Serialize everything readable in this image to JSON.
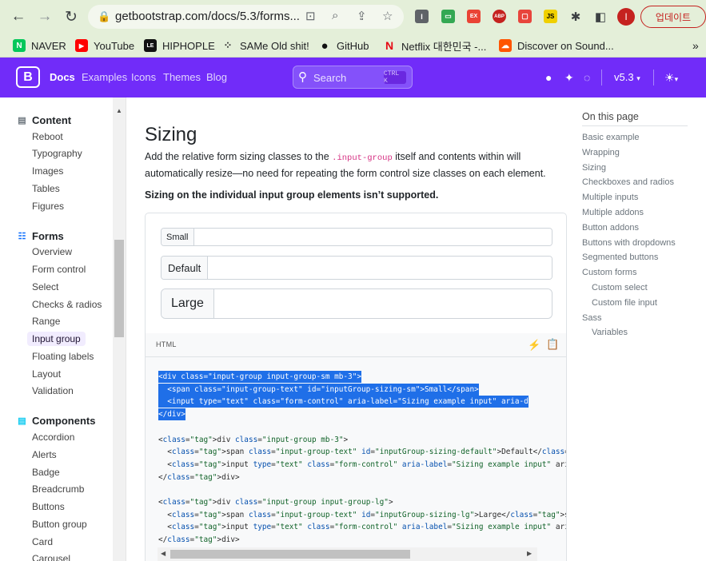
{
  "browser": {
    "url": "getbootstrap.com/docs/5.3/forms...",
    "update_label": "업데이트",
    "profile_initial": "I",
    "bookmarks": [
      {
        "label": "NAVER",
        "icon": "N"
      },
      {
        "label": "YouTube",
        "icon": "▶"
      },
      {
        "label": "HIPHOPLE",
        "icon": "LE"
      },
      {
        "label": "SAMe Old shit!",
        "icon": "⁘"
      },
      {
        "label": "GitHub",
        "icon": "●"
      },
      {
        "label": "Netflix 대한민국 -...",
        "icon": "N"
      },
      {
        "label": "Discover on Sound...",
        "icon": "☁"
      }
    ],
    "more_bookmarks": "»"
  },
  "navbar": {
    "logo": "B",
    "brand": "Docs",
    "links": [
      "Examples",
      "Icons",
      "Themes",
      "Blog"
    ],
    "search_placeholder": "Search",
    "search_kbd": "CTRL K",
    "version": "v5.3",
    "theme_caret": "▾"
  },
  "sidebar": {
    "sections": [
      {
        "title": "Content",
        "items": [
          "Reboot",
          "Typography",
          "Images",
          "Tables",
          "Figures"
        ]
      },
      {
        "title": "Forms",
        "items": [
          "Overview",
          "Form control",
          "Select",
          "Checks & radios",
          "Range",
          "Input group",
          "Floating labels",
          "Layout",
          "Validation"
        ]
      },
      {
        "title": "Components",
        "items": [
          "Accordion",
          "Alerts",
          "Badge",
          "Breadcrumb",
          "Buttons",
          "Button group",
          "Card",
          "Carousel"
        ]
      }
    ],
    "active_item": "Input group"
  },
  "main": {
    "title": "Sizing",
    "para_before": "Add the relative form sizing classes to the ",
    "para_code": ".input-group",
    "para_after": " itself and contents within will automatically resize—no need for repeating the form control size classes on each element.",
    "bold_note": "Sizing on the individual input group elements isn’t supported.",
    "examples": [
      {
        "label": "Small"
      },
      {
        "label": "Default"
      },
      {
        "label": "Large"
      }
    ],
    "code_lang": "HTML",
    "code_lines": [
      "<div class=\"input-group input-group-sm mb-3\">",
      "  <span class=\"input-group-text\" id=\"inputGroup-sizing-sm\">Small</span>",
      "  <input type=\"text\" class=\"form-control\" aria-label=\"Sizing example input\" aria-d",
      "</div>",
      "",
      "<div class=\"input-group mb-3\">",
      "  <span class=\"input-group-text\" id=\"inputGroup-sizing-default\">Default</span>",
      "  <input type=\"text\" class=\"form-control\" aria-label=\"Sizing example input\" aria-d",
      "</div>",
      "",
      "<div class=\"input-group input-group-lg\">",
      "  <span class=\"input-group-text\" id=\"inputGroup-sizing-lg\">Large</span>",
      "  <input type=\"text\" class=\"form-control\" aria-label=\"Sizing example input\" aria-d",
      "</div>"
    ],
    "selected_lines": 4
  },
  "toc": {
    "title": "On this page",
    "items": [
      {
        "label": "Basic example",
        "sub": false
      },
      {
        "label": "Wrapping",
        "sub": false
      },
      {
        "label": "Sizing",
        "sub": false
      },
      {
        "label": "Checkboxes and radios",
        "sub": false
      },
      {
        "label": "Multiple inputs",
        "sub": false
      },
      {
        "label": "Multiple addons",
        "sub": false
      },
      {
        "label": "Button addons",
        "sub": false
      },
      {
        "label": "Buttons with dropdowns",
        "sub": false
      },
      {
        "label": "Segmented buttons",
        "sub": false
      },
      {
        "label": "Custom forms",
        "sub": false
      },
      {
        "label": "Custom select",
        "sub": true
      },
      {
        "label": "Custom file input",
        "sub": true
      },
      {
        "label": "Sass",
        "sub": false
      },
      {
        "label": "Variables",
        "sub": true
      }
    ]
  },
  "colors": {
    "brand": "#712cf9",
    "chrome": "#e4efd9",
    "selection": "#1f6fe8"
  }
}
